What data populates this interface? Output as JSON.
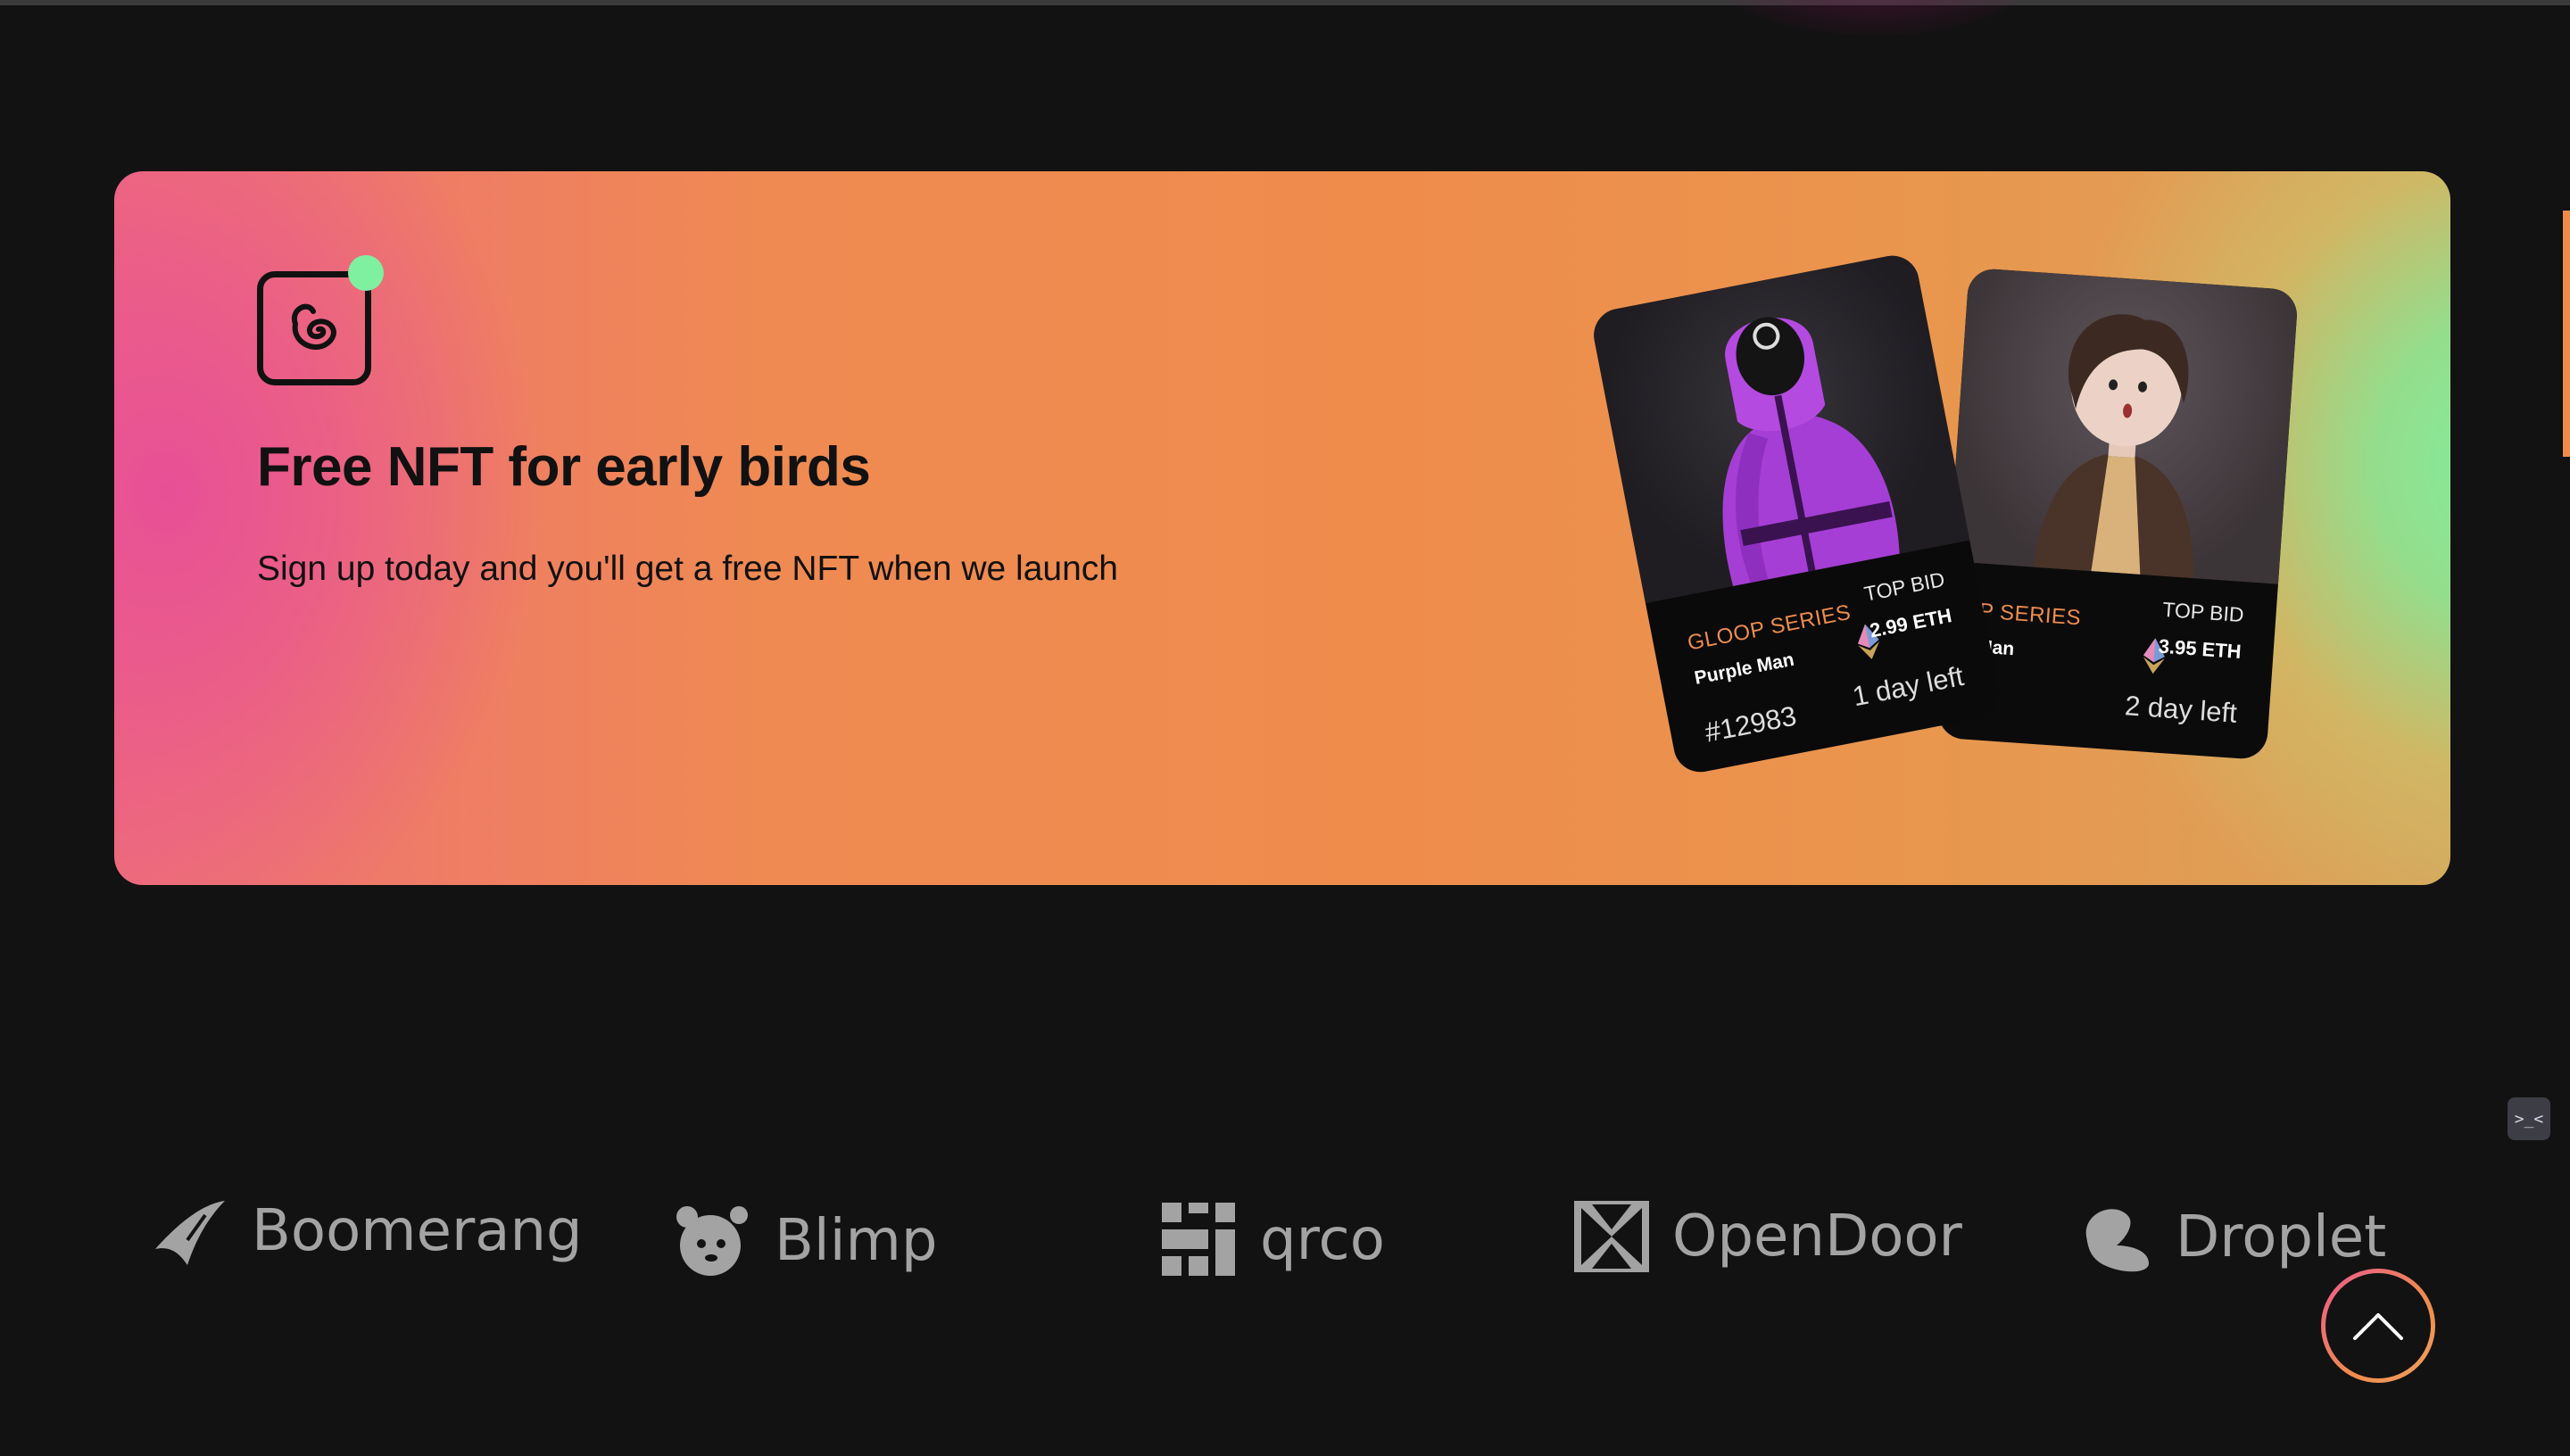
{
  "banner": {
    "title": "Free NFT for early birds",
    "subtitle": "Sign up today and you'll get a free NFT when we launch",
    "accent_colors": {
      "pink": "#e8509a",
      "orange": "#ef8c4c",
      "green": "#82ee9b"
    }
  },
  "cards": [
    {
      "series": "GLOOP SERIES",
      "name": "Purple Man",
      "top_bid_label": "TOP BID",
      "bid": "2.99 ETH",
      "token": "#12983",
      "time_left": "1 day left",
      "currency_icon": "ethereum-icon"
    },
    {
      "series": "P SERIES",
      "name": "Man",
      "top_bid_label": "TOP BID",
      "bid": "3.95 ETH",
      "time_left": "2 day left",
      "currency_icon": "ethereum-icon"
    }
  ],
  "partners": [
    {
      "name": "Boomerang",
      "icon": "boomerang-logo-icon"
    },
    {
      "name": "Blimp",
      "icon": "blimp-logo-icon"
    },
    {
      "name": "qrco",
      "icon": "qrco-logo-icon"
    },
    {
      "name": "OpenDoor",
      "icon": "opendoor-logo-icon"
    },
    {
      "name": "Droplet",
      "icon": "droplet-logo-icon"
    }
  ],
  "controls": {
    "dev_tool_glyph": ">_<",
    "scroll_top_icon": "chevron-up-icon"
  }
}
